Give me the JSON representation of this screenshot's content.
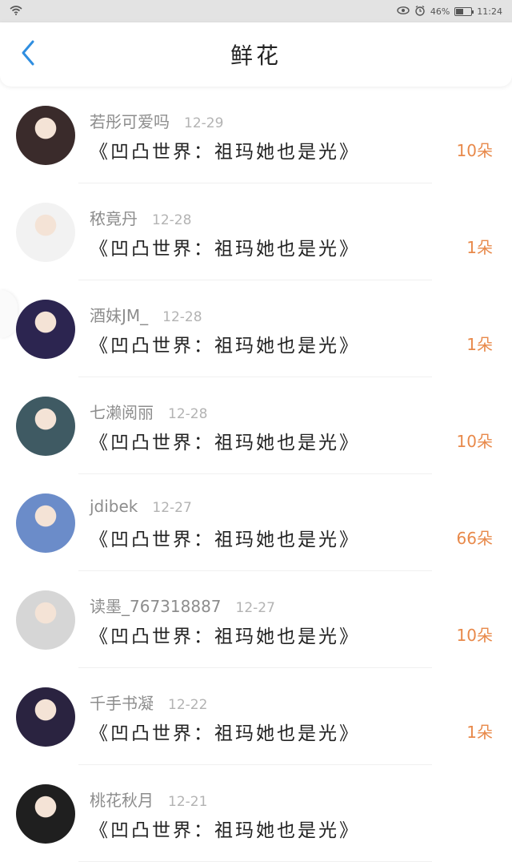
{
  "status_bar": {
    "battery": "46%",
    "time": "11:24",
    "battery_level": 0.46
  },
  "header": {
    "title": "鲜花"
  },
  "items": [
    {
      "name": "若彤可爱吗",
      "date": "12-29",
      "book": "《凹凸世界：祖玛她也是光》",
      "count": "10朵",
      "avatar_color": "#3a2b2b"
    },
    {
      "name": "秾竟丹",
      "date": "12-28",
      "book": "《凹凸世界：祖玛她也是光》",
      "count": "1朵",
      "avatar_color": "#f2f2f2"
    },
    {
      "name": "酒妹JM_",
      "date": "12-28",
      "book": "《凹凸世界：祖玛她也是光》",
      "count": "1朵",
      "avatar_color": "#2c2550"
    },
    {
      "name": "七濑阅丽",
      "date": "12-28",
      "book": "《凹凸世界：祖玛她也是光》",
      "count": "10朵",
      "avatar_color": "#3f5a63"
    },
    {
      "name": "jdibek",
      "date": "12-27",
      "book": "《凹凸世界：祖玛她也是光》",
      "count": "66朵",
      "avatar_color": "#6b8cc9"
    },
    {
      "name": "读墨_767318887",
      "date": "12-27",
      "book": "《凹凸世界：祖玛她也是光》",
      "count": "10朵",
      "avatar_color": "#d6d6d6"
    },
    {
      "name": "千手书凝",
      "date": "12-22",
      "book": "《凹凸世界：祖玛她也是光》",
      "count": "1朵",
      "avatar_color": "#2a2340"
    },
    {
      "name": "桃花秋月",
      "date": "12-21",
      "book": "《凹凸世界：祖玛她也是光》",
      "count": "",
      "avatar_color": "#1f1f1f"
    }
  ]
}
